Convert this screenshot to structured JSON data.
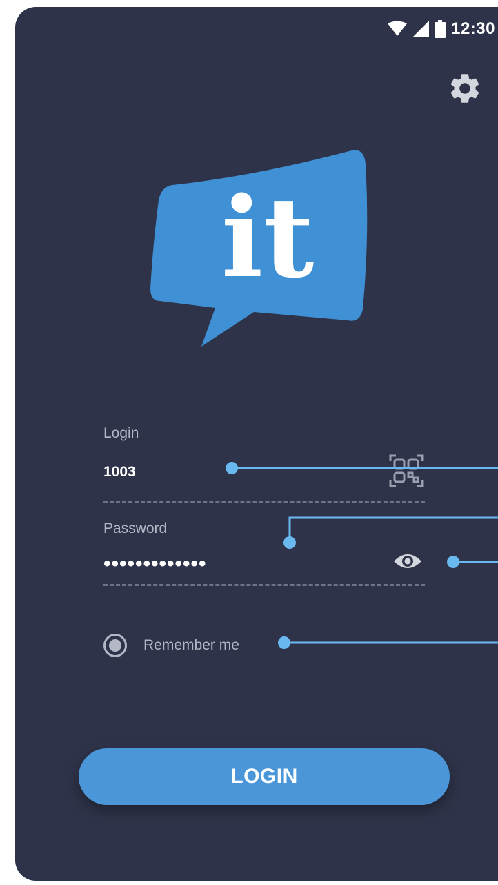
{
  "status_bar": {
    "time": "12:30",
    "icons": [
      "wifi-icon",
      "signal-icon",
      "battery-icon"
    ]
  },
  "header": {
    "settings_icon": "gear-icon"
  },
  "logo": {
    "text": "it"
  },
  "login_field": {
    "label": "Login",
    "value": "1003",
    "icon": "qr-scan-icon"
  },
  "password_field": {
    "label": "Password",
    "value": "•••••••••••••",
    "icon": "eye-icon"
  },
  "remember": {
    "label": "Remember me",
    "checked": true
  },
  "login_button": {
    "label": "LOGIN"
  },
  "colors": {
    "background": "#2e3349",
    "accent": "#4a96d8",
    "callout": "#6ab8f0",
    "muted_text": "#b3b7c6"
  }
}
